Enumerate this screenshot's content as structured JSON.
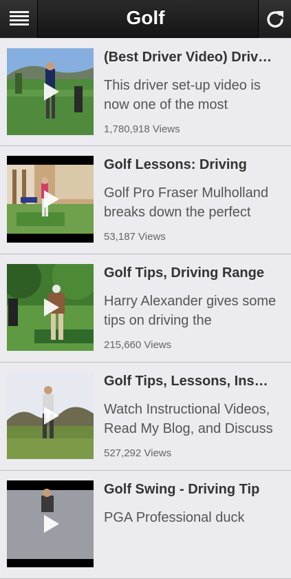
{
  "header": {
    "title": "Golf",
    "menu_icon": "hamburger-menu-icon",
    "refresh_icon": "refresh-icon"
  },
  "videos": [
    {
      "title": "(Best Driver Video) Driv…",
      "description": "This driver set-up video is now one of the most",
      "views": "1,780,918 Views"
    },
    {
      "title": "Golf Lessons: Driving",
      "description": "Golf Pro Fraser Mulholland breaks down the perfect",
      "views": "53,187 Views"
    },
    {
      "title": "Golf Tips, Driving Range",
      "description": "Harry Alexander gives some tips on driving the",
      "views": "215,660 Views"
    },
    {
      "title": "Golf Tips, Lessons, Ins…",
      "description": "Watch Instructional Videos, Read My Blog, and Discuss",
      "views": "527,292 Views"
    },
    {
      "title": "Golf Swing - Driving Tip",
      "description": "PGA Professional duck",
      "views": ""
    }
  ],
  "colors": {
    "header_bg": "#1c1c1c",
    "list_bg": "#ebebf0",
    "title_text": "#333333"
  }
}
